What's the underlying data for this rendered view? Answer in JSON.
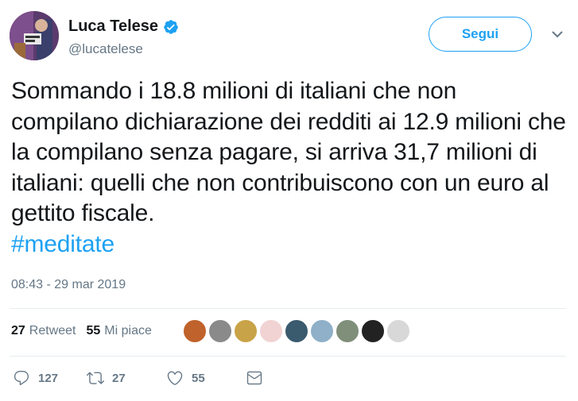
{
  "author": {
    "display_name": "Luca Telese",
    "handle": "@lucatelese",
    "verified": true
  },
  "follow_button": {
    "label": "Segui"
  },
  "tweet": {
    "text": "Sommando i 18.8 milioni di italiani che non compilano dichiarazione dei redditi ai 12.9 milioni che la compilano senza pagare, si arriva 31,7 milioni di italiani: quelli che non contribuiscono con un euro al gettito fiscale.",
    "hashtag": "#meditate",
    "timestamp": "08:43 - 29 mar 2019"
  },
  "stats": {
    "retweets_count": "27",
    "retweets_label": "Retweet",
    "likes_count": "55",
    "likes_label": "Mi piace"
  },
  "likers": [
    {
      "color": "#c0622b"
    },
    {
      "color": "#8a8a8a"
    },
    {
      "color": "#c9a347"
    },
    {
      "color": "#f1d3d3"
    },
    {
      "color": "#3a5a6e"
    },
    {
      "color": "#8fb0c8"
    },
    {
      "color": "#7f8f7a"
    },
    {
      "color": "#222222"
    },
    {
      "color": "#d8d8d8"
    }
  ],
  "actions": {
    "reply_count": "127",
    "retweet_count": "27",
    "like_count": "55"
  },
  "colors": {
    "accent": "#1da1f2",
    "secondary_text": "#657786",
    "divider": "#e6ecf0"
  }
}
